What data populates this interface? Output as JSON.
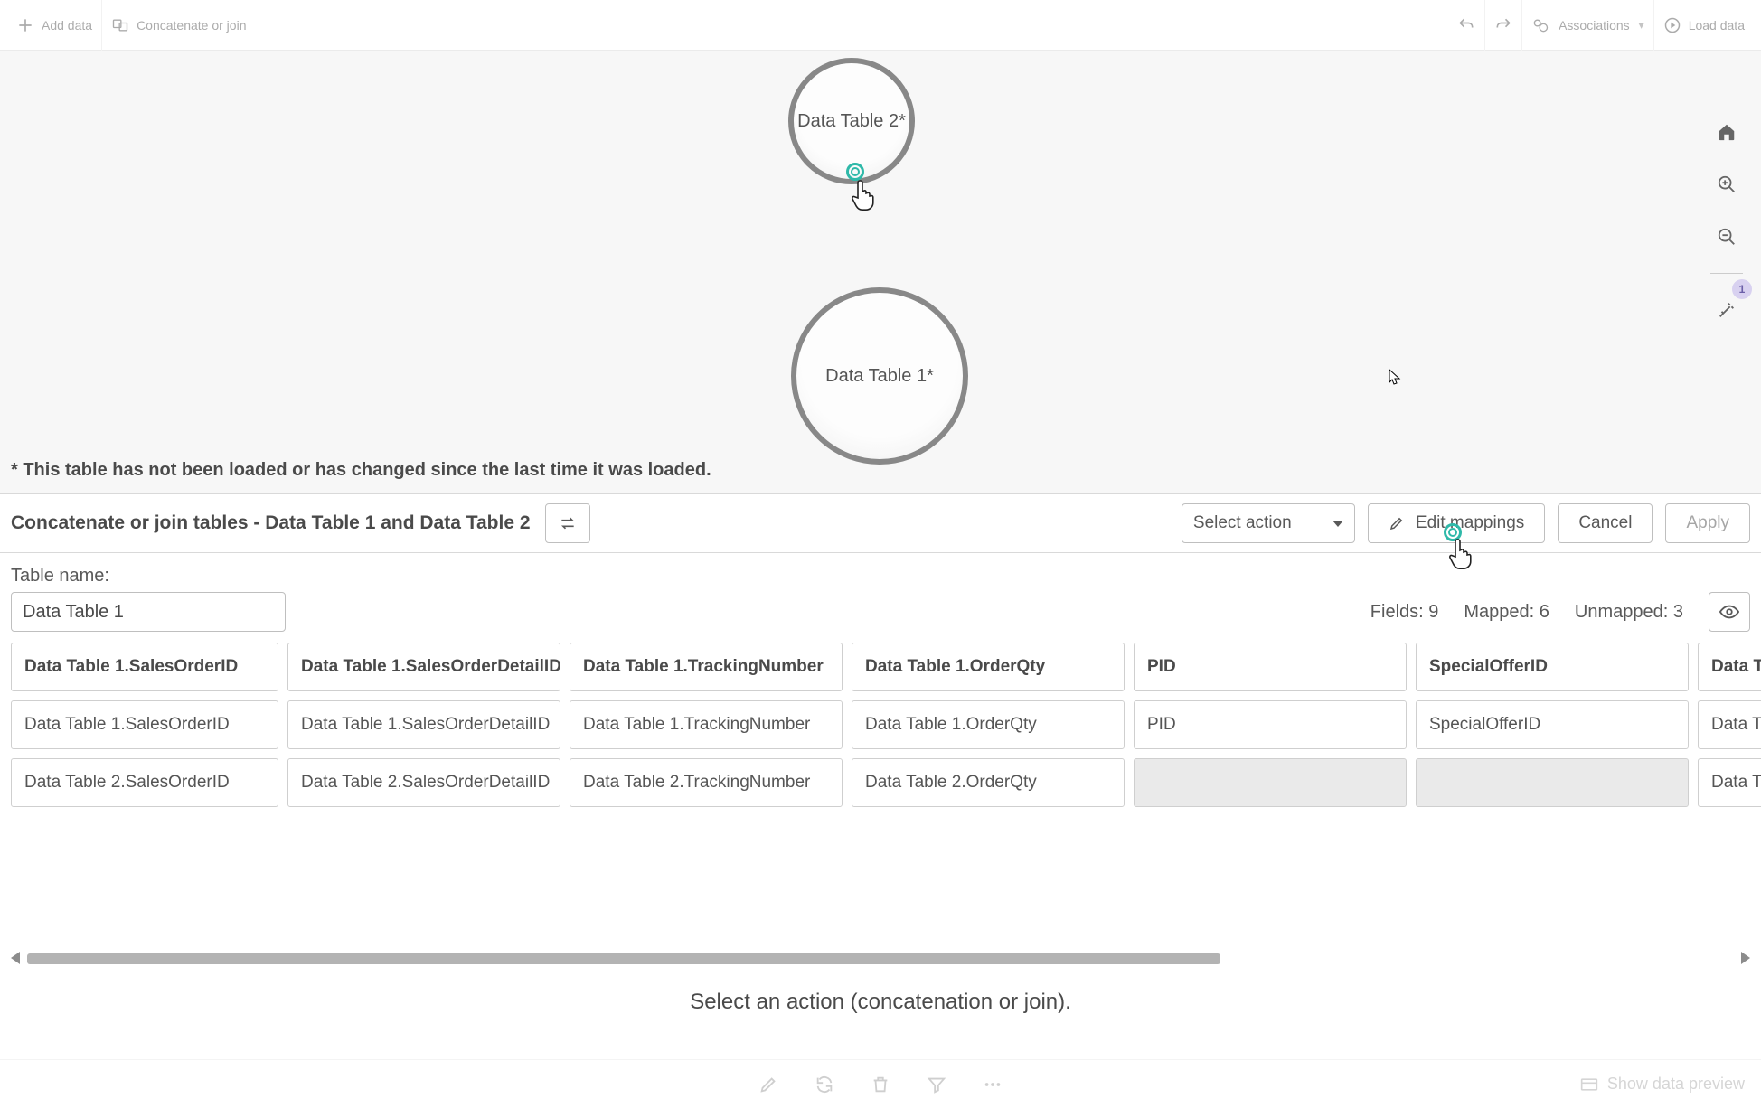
{
  "toolbar": {
    "add_data": "Add data",
    "concat_join": "Concatenate or join",
    "associations": "Associations",
    "load_data": "Load data"
  },
  "canvas": {
    "bubble2_label": "Data Table 2*",
    "bubble1_label": "Data Table 1*",
    "note": "* This table has not been loaded or has changed since the last time it was loaded."
  },
  "right_strip": {
    "badge": "1"
  },
  "action_bar": {
    "title": "Concatenate or join tables - Data Table 1 and Data Table 2",
    "select_action": "Select action",
    "edit_mappings": "Edit mappings",
    "cancel": "Cancel",
    "apply": "Apply"
  },
  "table_name": {
    "label": "Table name:",
    "value": "Data Table 1"
  },
  "counts": {
    "fields_label": "Fields: ",
    "fields_val": "9",
    "mapped_label": "Mapped: ",
    "mapped_val": "6",
    "unmapped_label": "Unmapped: ",
    "unmapped_val": "3"
  },
  "grid": {
    "headers": [
      "Data Table 1.SalesOrderID",
      "Data Table 1.SalesOrderDetailID",
      "Data Table 1.TrackingNumber",
      "Data Table 1.OrderQty",
      "PID",
      "SpecialOfferID",
      "Data Ta"
    ],
    "row1": [
      "Data Table 1.SalesOrderID",
      "Data Table 1.SalesOrderDetailID",
      "Data Table 1.TrackingNumber",
      "Data Table 1.OrderQty",
      "PID",
      "SpecialOfferID",
      "Data Ta"
    ],
    "row2": [
      "Data Table 2.SalesOrderID",
      "Data Table 2.SalesOrderDetailID",
      "Data Table 2.TrackingNumber",
      "Data Table 2.OrderQty",
      "",
      "",
      "Data Ta"
    ]
  },
  "instruction": "Select an action (concatenation or join).",
  "bottom": {
    "show_preview": "Show data preview"
  }
}
